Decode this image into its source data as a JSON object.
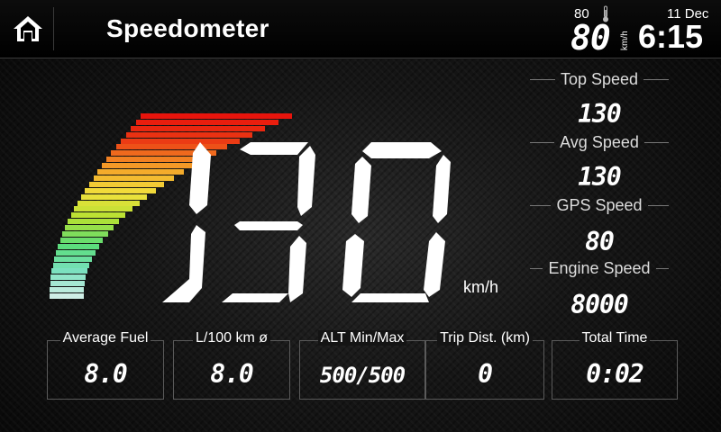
{
  "header": {
    "title": "Speedometer",
    "temperature": "80",
    "thermometer_icon": "thermometer-icon",
    "date": "11 Dec",
    "current_speed": "80",
    "speed_unit": "km/h",
    "time": "6:15",
    "home_icon": "home-icon"
  },
  "speedometer": {
    "value": "130",
    "unit": "km/h"
  },
  "stats": [
    {
      "label": "Top Speed",
      "value": "130"
    },
    {
      "label": "Avg Speed",
      "value": "130"
    },
    {
      "label": "GPS Speed",
      "value": "80"
    },
    {
      "label": "Engine Speed",
      "value": "8000"
    }
  ],
  "info_boxes": [
    {
      "label": "Average Fuel",
      "value": "8.0"
    },
    {
      "label": "L/100 km ø",
      "value": "8.0"
    },
    {
      "label": "ALT Min/Max",
      "value": "500/500"
    },
    {
      "label": "Trip Dist. (km)",
      "value": "0"
    },
    {
      "label": "Total Time",
      "value": "0:02"
    }
  ],
  "colors": {
    "gauge_low": "#cfeee6",
    "gauge_mid": "#e8e03a",
    "gauge_high": "#e81a10"
  }
}
